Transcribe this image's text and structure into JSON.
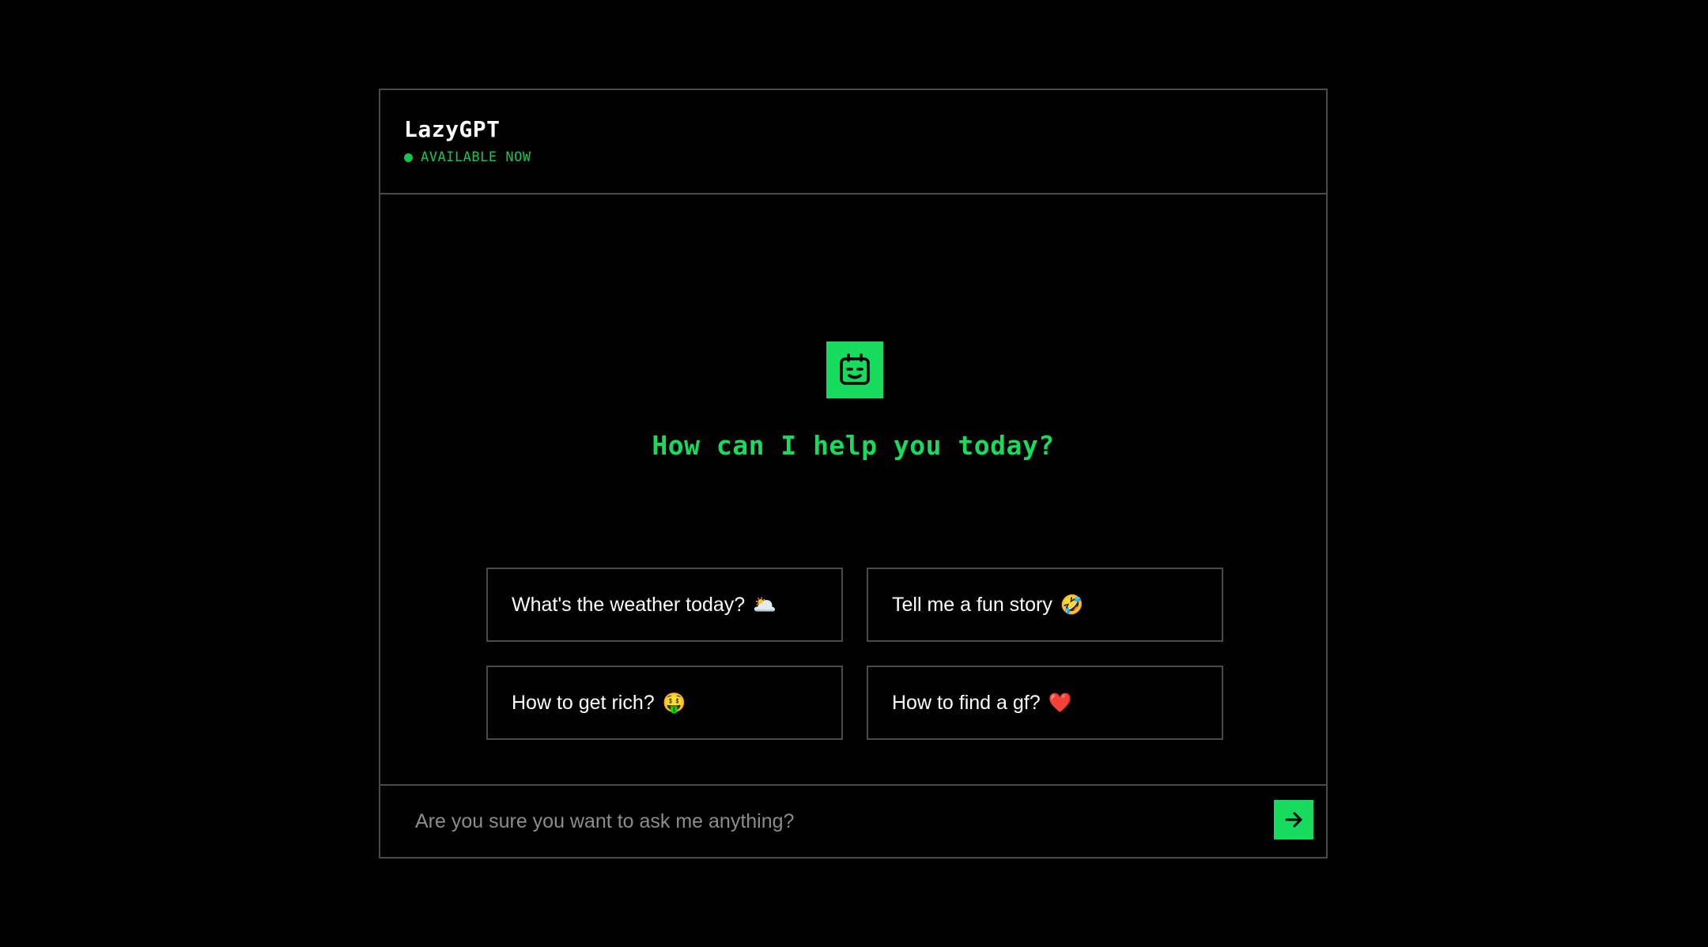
{
  "header": {
    "title": "LazyGPT",
    "status": "AVAILABLE NOW"
  },
  "main": {
    "icon": "bot-face-icon",
    "greeting": "How can I help you today?",
    "suggestions": [
      {
        "text": "What's the weather today?",
        "emoji": "🌥️"
      },
      {
        "text": "Tell me a fun story",
        "emoji": "🤣"
      },
      {
        "text": "How to get rich?",
        "emoji": "🤑"
      },
      {
        "text": "How to find a gf?",
        "emoji": "❤️"
      }
    ]
  },
  "composer": {
    "placeholder": "Are you sure you want to ask me anything?",
    "send_icon": "arrow-right-icon"
  },
  "colors": {
    "accent": "#16db5c",
    "status": "#16c653",
    "border": "#4a4a4a",
    "background": "#000000"
  }
}
